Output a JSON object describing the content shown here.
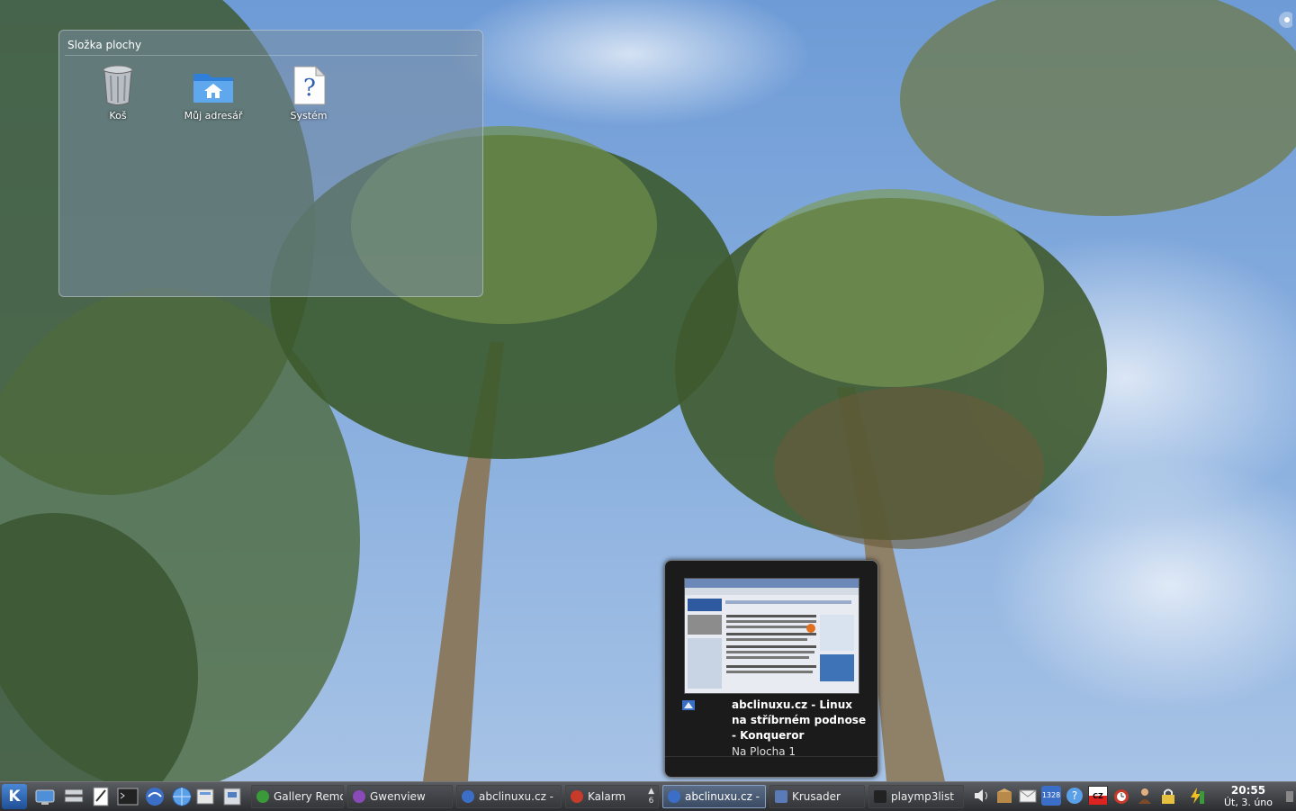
{
  "desktop": {
    "folder_title": "Složka plochy",
    "icons": [
      {
        "label": "Koš",
        "icon": "trash-icon"
      },
      {
        "label": "Můj adresář",
        "icon": "home-folder-icon"
      },
      {
        "label": "Systém",
        "icon": "system-unknown-icon"
      }
    ]
  },
  "tooltip": {
    "title": "abclinuxu.cz - Linux na stříbrném podnose - Konqueror",
    "subtitle": "Na Plocha 1"
  },
  "taskbar": {
    "start_icon": "k-menu-icon",
    "launchers": [
      "system-settings-icon",
      "drive-icon",
      "text-editor-icon",
      "terminal-icon",
      "konqueror-icon",
      "web-browser-icon",
      "file-manager-icon",
      "archive-icon"
    ],
    "tasks": [
      {
        "label": "Gallery Remote",
        "icon": "gallery-remote-icon",
        "active": false
      },
      {
        "label": "Gwenview",
        "icon": "gwenview-icon",
        "active": false
      },
      {
        "label": "abclinuxu.cz -",
        "icon": "konqueror-icon",
        "active": false
      },
      {
        "label": "Kalarm",
        "icon": "kalarm-icon",
        "active": false,
        "count": "6"
      },
      {
        "label": "abclinuxu.cz -",
        "icon": "konqueror-icon",
        "active": true
      },
      {
        "label": "Krusader",
        "icon": "krusader-icon",
        "active": false
      },
      {
        "label": "playmp3list",
        "icon": "terminal-icon",
        "active": false
      }
    ],
    "tray": [
      "volume-icon",
      "package-icon",
      "mail-icon",
      "network-monitor-icon",
      "help-icon",
      "keyboard-layout-icon",
      "alarm-clock-icon",
      "user-icon",
      "lock-icon",
      "power-icon"
    ],
    "tray_badges": {
      "network": "1328",
      "keyboard": "CZ"
    },
    "clock": {
      "time": "20:55",
      "date": "Út, 3. úno"
    }
  },
  "colors": {
    "sky": "#7fa6d8",
    "panel": "#3a3c40",
    "active_task": "#4a5b76"
  }
}
